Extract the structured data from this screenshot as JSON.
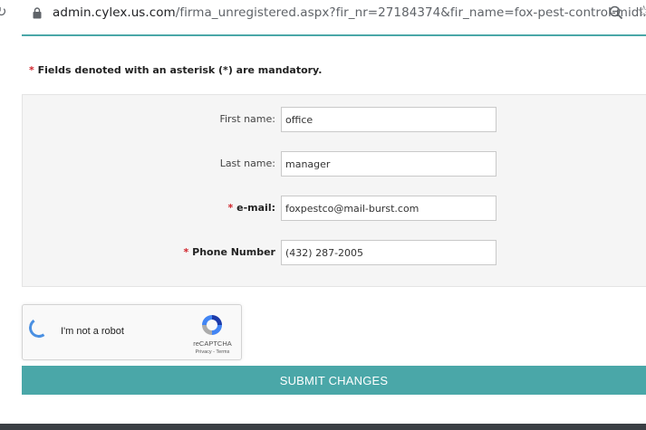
{
  "browser": {
    "url_host": "admin.cylex.us.com",
    "url_path": "/firma_unregistered.aspx?fir_nr=27184374&fir_name=fox-pest-control-midl..."
  },
  "form": {
    "mandatory_note": "Fields denoted with an asterisk (*) are mandatory.",
    "asterisk": "*",
    "fields": [
      {
        "label": "First name:",
        "value": "office",
        "required": false
      },
      {
        "label": "Last name:",
        "value": "manager",
        "required": false
      },
      {
        "label": "e-mail:",
        "value": "foxpestco@mail-burst.com",
        "required": true
      },
      {
        "label": "Phone Number",
        "value": "(432) 287-2005",
        "required": true
      }
    ]
  },
  "captcha": {
    "label": "I'm not a robot",
    "brand": "reCAPTCHA",
    "links": "Privacy - Terms"
  },
  "submit_label": "SUBMIT CHANGES",
  "colors": {
    "accent": "#4aa7a8",
    "required": "#d0232a"
  },
  "icons": [
    "reload-icon",
    "lock-icon",
    "zoom-icon",
    "star-icon",
    "recaptcha-logo-icon"
  ]
}
